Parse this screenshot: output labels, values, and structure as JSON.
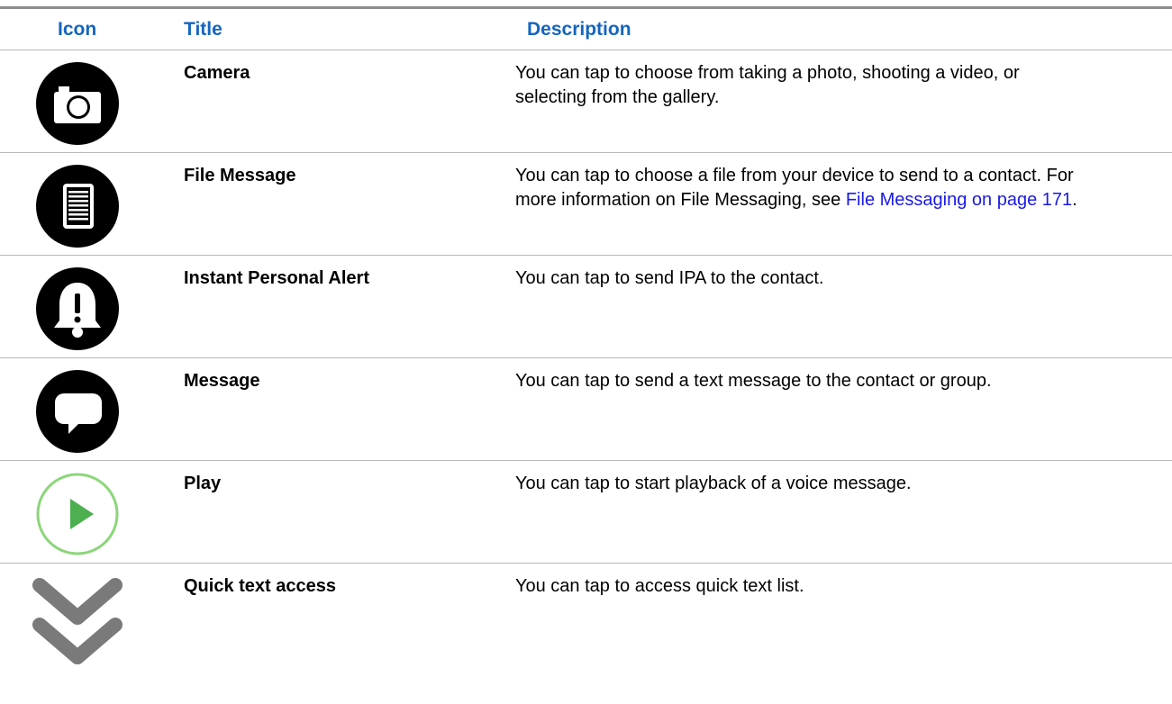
{
  "table": {
    "headers": {
      "icon": "Icon",
      "title": "Title",
      "description": "Description"
    },
    "rows": [
      {
        "icon": "camera-icon",
        "title": "Camera",
        "description": "You can tap to choose from taking a photo, shooting a video, or selecting from the gallery."
      },
      {
        "icon": "file-message-icon",
        "title": "File Message",
        "description_prefix": "You can tap to choose a file from your device to send to a contact. For more information on File Messaging, see ",
        "link_text": "File Messaging on page 171",
        "description_suffix": "."
      },
      {
        "icon": "bell-alert-icon",
        "title": "Instant Personal Alert",
        "description": "You can tap to send IPA to the contact."
      },
      {
        "icon": "speech-bubble-icon",
        "title": "Message",
        "description": "You can tap to send a text message to the contact or group."
      },
      {
        "icon": "play-icon",
        "title": "Play",
        "description": "You can tap to start playback of a voice message."
      },
      {
        "icon": "double-chevron-down-icon",
        "title": "Quick text access",
        "description": "You can tap to access quick text list."
      }
    ]
  },
  "colors": {
    "header_text": "#1565c0",
    "link": "#1a1ae6",
    "play_green": "#4caf50",
    "chevron_gray": "#7a7a7a"
  }
}
